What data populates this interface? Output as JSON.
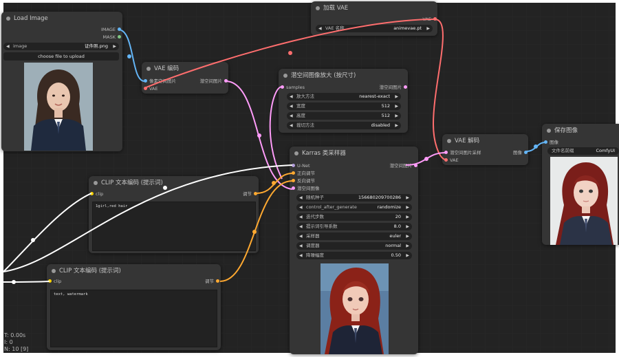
{
  "colors": {
    "image_link": "#64b5f6",
    "latent_link": "#ff9cf9",
    "vae_link": "#ff6e6e",
    "clip_link": "#ffffff",
    "cond_link": "#ffa931",
    "mask_link": "#81c784"
  },
  "nodes": {
    "load_image": {
      "title": "Load Image",
      "outputs": [
        "IMAGE",
        "MASK"
      ],
      "image_widget": {
        "label": "image",
        "value": "证件照.png"
      },
      "upload_button": "choose file to upload"
    },
    "vae_loader": {
      "title": "加载 VAE",
      "output": "VAE",
      "widget": {
        "label": "VAE 名称",
        "value": "animevae.pt"
      }
    },
    "vae_encode": {
      "title": "VAE 编码",
      "inputs": [
        "像素空间图片",
        "VAE"
      ],
      "output": "潜空间图片"
    },
    "latent_upscale": {
      "title": "潜空间图像放大 (按尺寸)",
      "input": "samples",
      "output": "潜空间图片",
      "widgets": [
        {
          "label": "放大方法",
          "value": "nearest-exact"
        },
        {
          "label": "宽度",
          "value": "512"
        },
        {
          "label": "高度",
          "value": "512"
        },
        {
          "label": "裁切方法",
          "value": "disabled"
        }
      ]
    },
    "vae_decode": {
      "title": "VAE 解码",
      "inputs": [
        "潜空间图片采样",
        "VAE"
      ],
      "output": "图像"
    },
    "save_image": {
      "title": "保存图像",
      "input": "图像",
      "widget": {
        "label": "文件名前缀",
        "value": "ComfyUI"
      }
    },
    "ksampler": {
      "title": "Karras 类采样器",
      "inputs": [
        "U-Net",
        "正向调节",
        "反向调节",
        "潜空间图像"
      ],
      "output": "潜空间图片",
      "widgets": [
        {
          "label": "随机种子",
          "value": "156680209700286"
        },
        {
          "label": "control_after_generate",
          "value": "randomize"
        },
        {
          "label": "迭代步数",
          "value": "20"
        },
        {
          "label": "提示词引导系数",
          "value": "8.0"
        },
        {
          "label": "采样器",
          "value": "euler"
        },
        {
          "label": "调度器",
          "value": "normal"
        },
        {
          "label": "降噪幅度",
          "value": "0.50"
        }
      ]
    },
    "clip_pos": {
      "title": "CLIP 文本编码 (提示词)",
      "input": "clip",
      "output": "调节",
      "text": "1girl,red hair"
    },
    "clip_neg": {
      "title": "CLIP 文本编码 (提示词)",
      "input": "clip",
      "output": "调节",
      "text": "text, watermark"
    }
  },
  "stats": {
    "line1": "T: 0.00s",
    "line2": "I: 0",
    "line3": "N: 10 [9]"
  }
}
